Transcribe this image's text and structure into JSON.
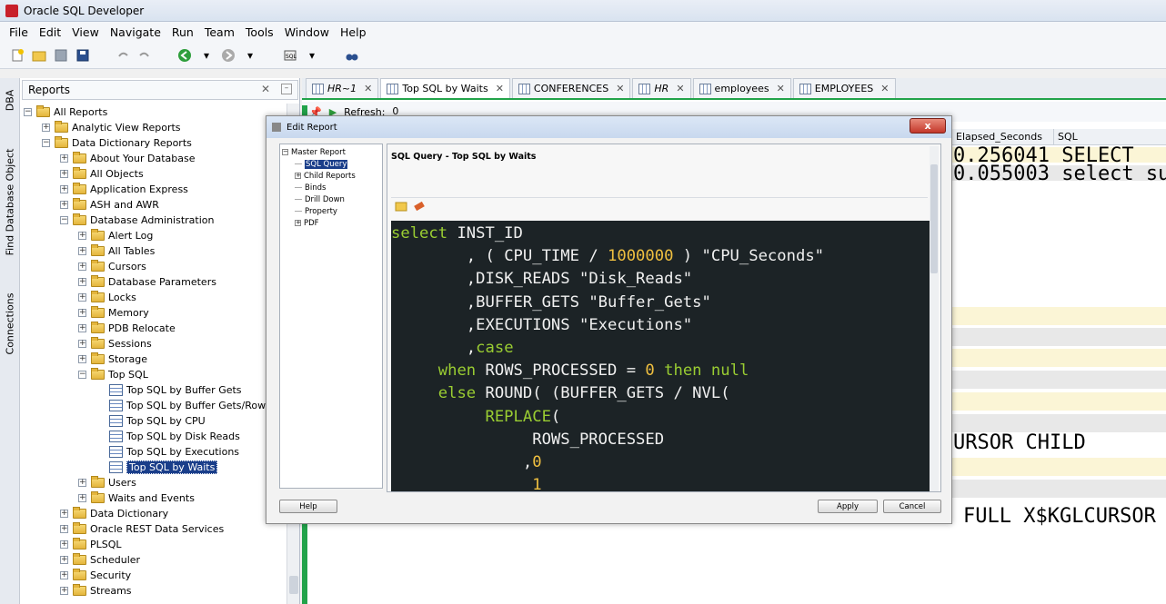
{
  "app": {
    "title": "Oracle SQL Developer"
  },
  "menu": [
    "File",
    "Edit",
    "View",
    "Navigate",
    "Run",
    "Team",
    "Tools",
    "Window",
    "Help"
  ],
  "side_tabs": {
    "dba": "DBA",
    "find": "Find Database Object",
    "connections": "Connections"
  },
  "reports_panel": {
    "title": "Reports",
    "tree": [
      {
        "label": "All Reports",
        "level": 0,
        "expander": "minus",
        "icon": "folder"
      },
      {
        "label": "Analytic View Reports",
        "level": 1,
        "expander": "plus",
        "icon": "folder"
      },
      {
        "label": "Data Dictionary Reports",
        "level": 1,
        "expander": "minus",
        "icon": "folder"
      },
      {
        "label": "About Your Database",
        "level": 2,
        "expander": "plus",
        "icon": "folder"
      },
      {
        "label": "All Objects",
        "level": 2,
        "expander": "plus",
        "icon": "folder"
      },
      {
        "label": "Application Express",
        "level": 2,
        "expander": "plus",
        "icon": "folder"
      },
      {
        "label": "ASH and AWR",
        "level": 2,
        "expander": "plus",
        "icon": "folder"
      },
      {
        "label": "Database Administration",
        "level": 2,
        "expander": "minus",
        "icon": "folder"
      },
      {
        "label": "Alert Log",
        "level": 3,
        "expander": "plus",
        "icon": "folder"
      },
      {
        "label": "All Tables",
        "level": 3,
        "expander": "plus",
        "icon": "folder"
      },
      {
        "label": "Cursors",
        "level": 3,
        "expander": "plus",
        "icon": "folder"
      },
      {
        "label": "Database Parameters",
        "level": 3,
        "expander": "plus",
        "icon": "folder"
      },
      {
        "label": "Locks",
        "level": 3,
        "expander": "plus",
        "icon": "folder"
      },
      {
        "label": "Memory",
        "level": 3,
        "expander": "plus",
        "icon": "folder"
      },
      {
        "label": "PDB Relocate",
        "level": 3,
        "expander": "plus",
        "icon": "folder"
      },
      {
        "label": "Sessions",
        "level": 3,
        "expander": "plus",
        "icon": "folder"
      },
      {
        "label": "Storage",
        "level": 3,
        "expander": "plus",
        "icon": "folder"
      },
      {
        "label": "Top SQL",
        "level": 3,
        "expander": "minus",
        "icon": "folder"
      },
      {
        "label": "Top SQL by Buffer Gets",
        "level": 4,
        "expander": "none",
        "icon": "report"
      },
      {
        "label": "Top SQL by Buffer Gets/Rows Proc",
        "level": 4,
        "expander": "none",
        "icon": "report"
      },
      {
        "label": "Top SQL by CPU",
        "level": 4,
        "expander": "none",
        "icon": "report"
      },
      {
        "label": "Top SQL by Disk Reads",
        "level": 4,
        "expander": "none",
        "icon": "report"
      },
      {
        "label": "Top SQL by Executions",
        "level": 4,
        "expander": "none",
        "icon": "report"
      },
      {
        "label": "Top SQL by Waits",
        "level": 4,
        "expander": "none",
        "icon": "report",
        "selected": true
      },
      {
        "label": "Users",
        "level": 3,
        "expander": "plus",
        "icon": "folder"
      },
      {
        "label": "Waits and Events",
        "level": 3,
        "expander": "plus",
        "icon": "folder"
      },
      {
        "label": "Data Dictionary",
        "level": 2,
        "expander": "plus",
        "icon": "folder"
      },
      {
        "label": "Oracle REST Data Services",
        "level": 2,
        "expander": "plus",
        "icon": "folder"
      },
      {
        "label": "PLSQL",
        "level": 2,
        "expander": "plus",
        "icon": "folder"
      },
      {
        "label": "Scheduler",
        "level": 2,
        "expander": "plus",
        "icon": "folder"
      },
      {
        "label": "Security",
        "level": 2,
        "expander": "plus",
        "icon": "folder"
      },
      {
        "label": "Streams",
        "level": 2,
        "expander": "plus",
        "icon": "folder"
      }
    ]
  },
  "editor_tabs": [
    {
      "label": "HR~1",
      "italic": true
    },
    {
      "label": "Top SQL by Waits",
      "italic": false,
      "active": true
    },
    {
      "label": "CONFERENCES",
      "italic": false
    },
    {
      "label": "HR",
      "italic": true
    },
    {
      "label": "employees",
      "italic": false
    },
    {
      "label": "EMPLOYEES",
      "italic": false
    }
  ],
  "editor_toolbar": {
    "refresh_label": "Refresh:",
    "refresh_value": "0"
  },
  "grid": {
    "headers": [
      "Elapsed_Seconds",
      "SQL"
    ],
    "bg_text": [
      "0.256041 SELECT",
      "0.055003 select su",
      "URSOR CHILD",
      "FULL X$KGLCURSOR"
    ]
  },
  "dialog": {
    "title": "Edit Report",
    "close_label": "x",
    "nav": [
      {
        "label": "Master Report",
        "level": 0,
        "expander": "minus"
      },
      {
        "label": "SQL Query",
        "level": 1,
        "expander": "none",
        "selected": true
      },
      {
        "label": "Child Reports",
        "level": 1,
        "expander": "plus"
      },
      {
        "label": "Binds",
        "level": 1,
        "expander": "none"
      },
      {
        "label": "Drill Down",
        "level": 1,
        "expander": "none"
      },
      {
        "label": "Property",
        "level": 1,
        "expander": "none"
      },
      {
        "label": "PDF",
        "level": 1,
        "expander": "plus"
      }
    ],
    "content_title": "SQL Query - Top SQL by Waits",
    "code": [
      {
        "indent": "",
        "parts": [
          {
            "t": "select",
            "c": "kw"
          },
          {
            "t": " INST_ID",
            "c": ""
          }
        ]
      },
      {
        "indent": "        ",
        "parts": [
          {
            "t": ", ( CPU_TIME / ",
            "c": ""
          },
          {
            "t": "1000000",
            "c": "num"
          },
          {
            "t": " ) \"CPU_Seconds\"",
            "c": ""
          }
        ]
      },
      {
        "indent": "        ",
        "parts": [
          {
            "t": ",DISK_READS \"Disk_Reads\"",
            "c": ""
          }
        ]
      },
      {
        "indent": "        ",
        "parts": [
          {
            "t": ",BUFFER_GETS \"Buffer_Gets\"",
            "c": ""
          }
        ]
      },
      {
        "indent": "        ",
        "parts": [
          {
            "t": ",EXECUTIONS \"Executions\"",
            "c": ""
          }
        ]
      },
      {
        "indent": "        ",
        "parts": [
          {
            "t": ",",
            "c": ""
          },
          {
            "t": "case",
            "c": "kw"
          }
        ]
      },
      {
        "indent": "     ",
        "parts": [
          {
            "t": "when",
            "c": "kw"
          },
          {
            "t": " ROWS_PROCESSED = ",
            "c": ""
          },
          {
            "t": "0",
            "c": "num"
          },
          {
            "t": " ",
            "c": ""
          },
          {
            "t": "then",
            "c": "kw"
          },
          {
            "t": " ",
            "c": ""
          },
          {
            "t": "null",
            "c": "kw"
          }
        ]
      },
      {
        "indent": "     ",
        "parts": [
          {
            "t": "else",
            "c": "kw"
          },
          {
            "t": " ROUND( (BUFFER_GETS / NVL(",
            "c": ""
          }
        ]
      },
      {
        "indent": "          ",
        "parts": [
          {
            "t": "REPLACE",
            "c": "kw"
          },
          {
            "t": "(",
            "c": ""
          }
        ]
      },
      {
        "indent": "               ",
        "parts": [
          {
            "t": "ROWS_PROCESSED",
            "c": ""
          }
        ]
      },
      {
        "indent": "              ",
        "parts": [
          {
            "t": ",",
            "c": ""
          },
          {
            "t": "0",
            "c": "num"
          }
        ]
      },
      {
        "indent": "               ",
        "parts": [
          {
            "t": "1",
            "c": "num"
          }
        ]
      }
    ],
    "buttons": {
      "help": "Help",
      "apply": "Apply",
      "cancel": "Cancel"
    }
  }
}
